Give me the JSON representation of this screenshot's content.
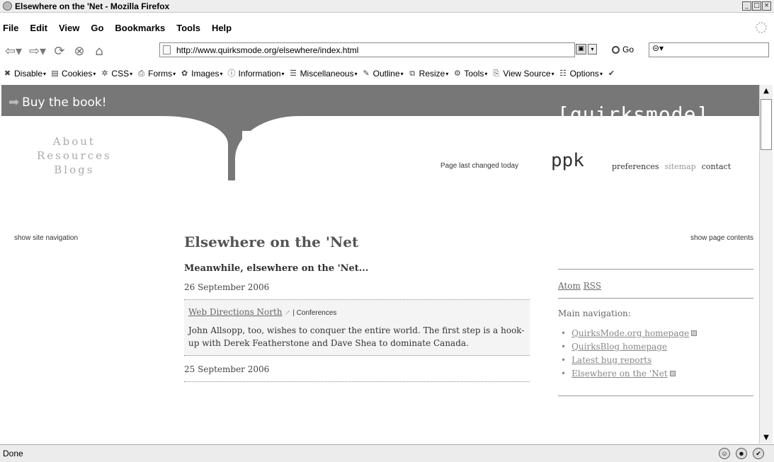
{
  "window": {
    "title": "Elsewhere on the 'Net - Mozilla Firefox"
  },
  "menu": [
    "File",
    "Edit",
    "View",
    "Go",
    "Bookmarks",
    "Tools",
    "Help"
  ],
  "navbar": {
    "url": "http://www.quirksmode.org/elsewhere/index.html",
    "go_label": "Go"
  },
  "devbar": [
    "Disable",
    "Cookies",
    "CSS",
    "Forms",
    "Images",
    "Information",
    "Miscellaneous",
    "Outline",
    "Resize",
    "Tools",
    "View Source",
    "Options"
  ],
  "page": {
    "buy_book": "Buy the book!",
    "logo": "[quirksmode]",
    "ppk": "ppk",
    "sidenav": [
      "About",
      "Resources",
      "Blogs"
    ],
    "last_changed": "Page last changed today",
    "toplinks": [
      "preferences",
      "sitemap",
      "contact"
    ],
    "show_site_nav": "show site navigation",
    "show_page_contents": "show page contents",
    "title": "Elsewhere on the 'Net",
    "intro": "Meanwhile, elsewhere on the 'Net...",
    "date1": "26 September 2006",
    "entry": {
      "link": "Web Directions North",
      "category": "| Conferences",
      "body": "John Allsopp, too, wishes to conquer the entire world. The first step is a hook-up with Derek Featherstone and Dave Shea to dominate Canada."
    },
    "date2": "25 September 2006",
    "feeds": [
      "Atom",
      "RSS"
    ],
    "main_nav_title": "Main navigation:",
    "main_nav": [
      "QuirksMode.org homepage",
      "QuirksBlog homepage",
      "Latest bug reports",
      "Elsewhere on the 'Net"
    ]
  },
  "status": {
    "text": "Done"
  }
}
